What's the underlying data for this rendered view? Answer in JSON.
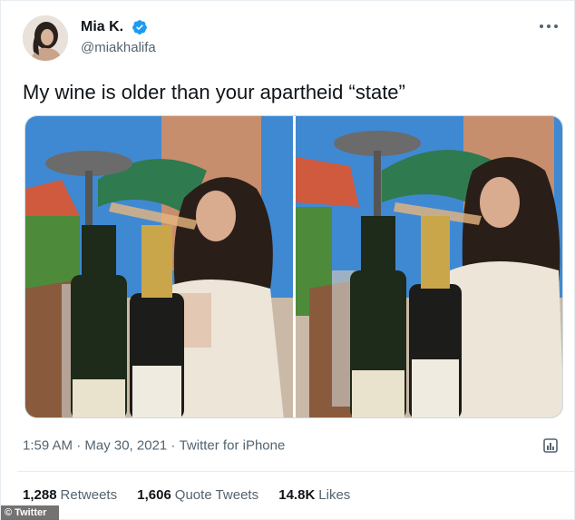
{
  "author": {
    "display_name": "Mia K.",
    "handle": "@miakhalifa",
    "verified": true,
    "avatar_icon": "profile-avatar"
  },
  "tweet": {
    "text": "My wine is older than your apartheid “state”",
    "timestamp": "1:59 AM · May 30, 2021 · ",
    "source": "Twitter for iPhone",
    "media_count": 2
  },
  "stats": {
    "retweets_count": "1,288",
    "retweets_label": "Retweets",
    "quotes_count": "1,606",
    "quotes_label": "Quote Tweets",
    "likes_count": "14.8K",
    "likes_label": "Likes"
  },
  "watermark": "© Twitter",
  "colors": {
    "verified": "#1d9bf0",
    "secondary_text": "#536471",
    "primary_text": "#0f1419",
    "border": "#cfd9de"
  }
}
